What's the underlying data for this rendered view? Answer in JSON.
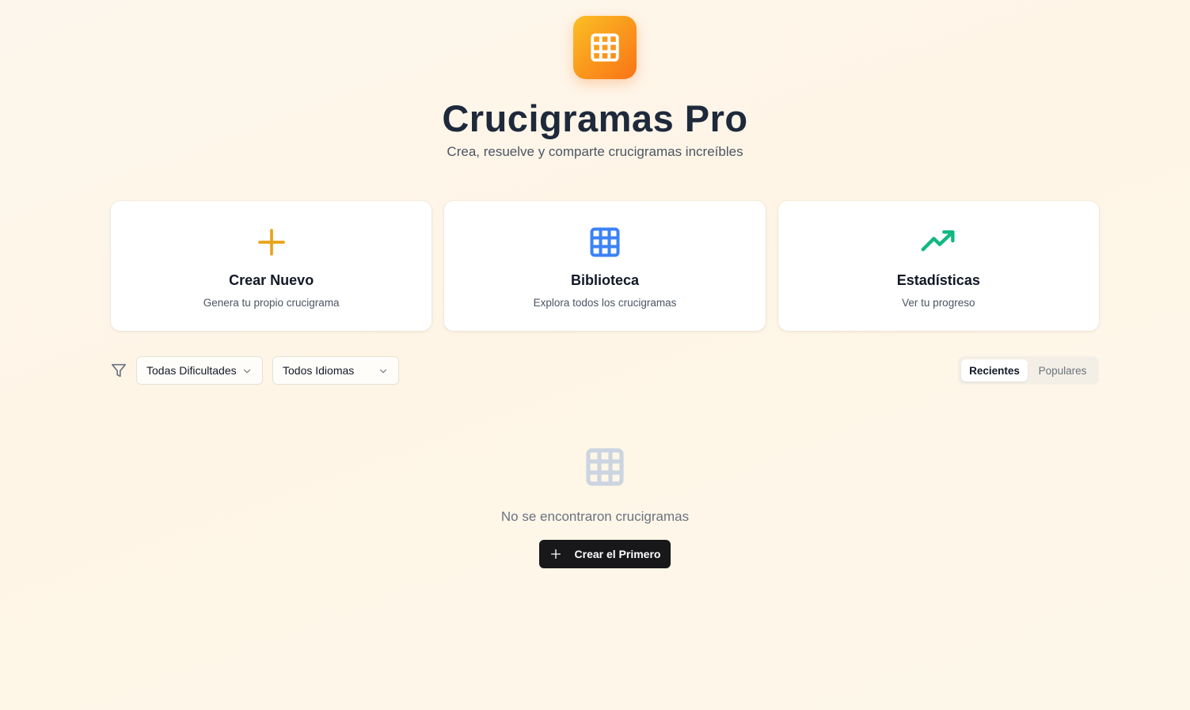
{
  "header": {
    "logo_icon": "grid-icon",
    "title": "Crucigramas Pro",
    "subtitle": "Crea, resuelve y comparte crucigramas increíbles",
    "logo_gradient": [
      "#fbbf24",
      "#f97316"
    ]
  },
  "cards": [
    {
      "icon": "plus-icon",
      "icon_color": "#e8a317",
      "title": "Crear Nuevo",
      "description": "Genera tu propio crucigrama"
    },
    {
      "icon": "grid-icon",
      "icon_color": "#3b82f6",
      "title": "Biblioteca",
      "description": "Explora todos los crucigramas"
    },
    {
      "icon": "trending-up-icon",
      "icon_color": "#10b981",
      "title": "Estadísticas",
      "description": "Ver tu progreso"
    }
  ],
  "filters": {
    "icon": "filter-icon",
    "difficulty": {
      "selected": "Todas Dificultades"
    },
    "language": {
      "selected": "Todos Idiomas"
    }
  },
  "sort_tabs": [
    {
      "label": "Recientes",
      "active": true
    },
    {
      "label": "Populares",
      "active": false
    }
  ],
  "empty_state": {
    "icon": "grid-icon",
    "message": "No se encontraron crucigramas",
    "button_label": "Crear el Primero"
  }
}
